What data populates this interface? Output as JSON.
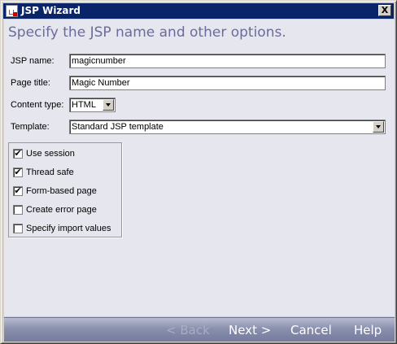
{
  "window": {
    "title": "JSP Wizard",
    "close_label": "X"
  },
  "heading": "Specify the JSP name and other options.",
  "fields": {
    "jsp_name": {
      "label": "JSP name:",
      "value": "magicnumber"
    },
    "page_title": {
      "label": "Page title:",
      "value": "Magic Number"
    },
    "content_type": {
      "label": "Content type:",
      "value": "HTML"
    },
    "template": {
      "label": "Template:",
      "value": "Standard JSP template"
    }
  },
  "options": [
    {
      "label": "Use session",
      "checked": true
    },
    {
      "label": "Thread safe",
      "checked": true
    },
    {
      "label": "Form-based page",
      "checked": true
    },
    {
      "label": "Create error page",
      "checked": false
    },
    {
      "label": "Specify import values",
      "checked": false
    }
  ],
  "buttons": {
    "back": "< Back",
    "next": "Next >",
    "cancel": "Cancel",
    "help": "Help"
  },
  "colors": {
    "title_bar": "#0a246a",
    "heading_text": "#6b6b9c",
    "content_bg": "#e6e6ee"
  }
}
